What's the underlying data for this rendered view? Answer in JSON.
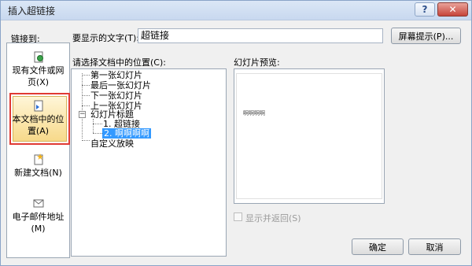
{
  "window": {
    "title": "插入超链接",
    "help_label": "?",
    "close_label": "✕"
  },
  "link_to": {
    "label": "链接到:",
    "items": [
      {
        "label_line1": "现有文件或网",
        "label_line2": "页(X)",
        "icon": "file-globe-icon"
      },
      {
        "label_line1": "本文档中的位",
        "label_line2": "置(A)",
        "icon": "document-place-icon"
      },
      {
        "label_line1": "新建文档(N)",
        "label_line2": "",
        "icon": "new-document-icon"
      },
      {
        "label_line1": "电子邮件地址",
        "label_line2": "(M)",
        "icon": "email-icon"
      }
    ],
    "selected_index": 1
  },
  "display_text": {
    "label": "要显示的文字(T):",
    "value": "超链接",
    "screentip_button": "屏幕提示(P)..."
  },
  "place_list": {
    "label": "请选择文档中的位置(C):",
    "nodes": [
      "第一张幻灯片",
      "最后一张幻灯片",
      "下一张幻灯片",
      "上一张幻灯片",
      "幻灯片标题",
      "1. 超链接",
      "2. 啊啊啊啊",
      "自定义放映"
    ],
    "expander_symbol": "−"
  },
  "preview": {
    "label": "幻灯片预览:",
    "slide_text": "啊啊啊啊",
    "show_and_return": "显示并返回(S)"
  },
  "buttons": {
    "ok": "确定",
    "cancel": "取消"
  },
  "colors": {
    "selection": "#3399ff",
    "highlight_border": "#e03a34"
  }
}
